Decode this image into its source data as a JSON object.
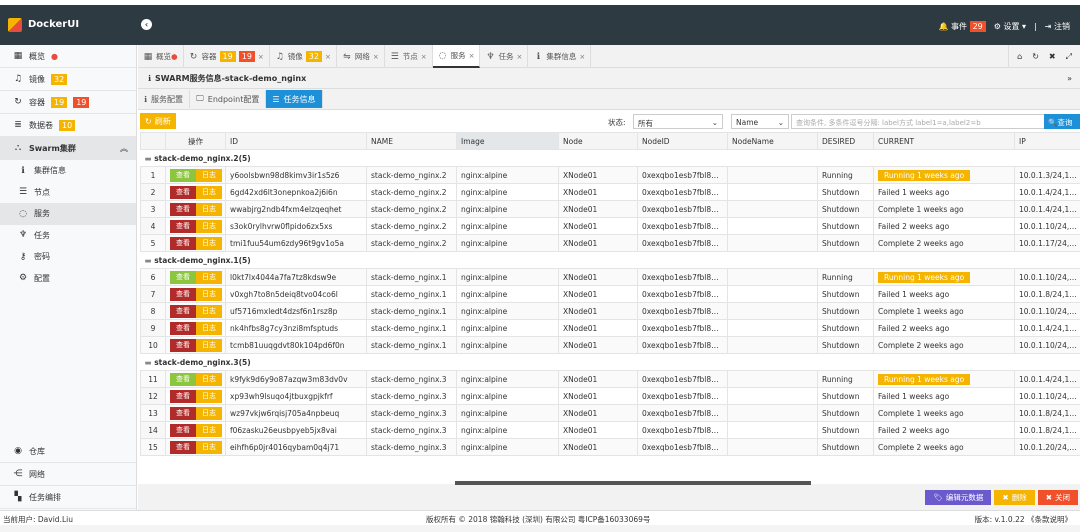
{
  "app": {
    "title": "DockerUI"
  },
  "header": {
    "events_label": "事件",
    "events_count": "29",
    "settings_label": "设置",
    "logout_label": "注销"
  },
  "sidebar": {
    "items": [
      {
        "label": "概览",
        "icon": "windows-icon",
        "dot": true
      },
      {
        "label": "镜像",
        "icon": "headphones-icon",
        "badge": "32"
      },
      {
        "label": "容器",
        "icon": "refresh-icon",
        "badge": "19",
        "badge2": "19"
      },
      {
        "label": "数据卷",
        "icon": "database-icon",
        "badge": "10"
      },
      {
        "label": "Swarm集群",
        "icon": "sitemap-icon",
        "expanded": true
      }
    ],
    "sub": [
      {
        "label": "集群信息",
        "icon": "info-icon"
      },
      {
        "label": "节点",
        "icon": "server-icon"
      },
      {
        "label": "服务",
        "icon": "spinner-icon",
        "active": true
      },
      {
        "label": "任务",
        "icon": "rebel-icon"
      },
      {
        "label": "密码",
        "icon": "key-icon"
      },
      {
        "label": "配置",
        "icon": "gear-icon"
      }
    ],
    "bottom": [
      {
        "label": "仓库",
        "icon": "repo-icon"
      },
      {
        "label": "网络",
        "icon": "network-icon"
      },
      {
        "label": "任务编排",
        "icon": "compose-icon"
      }
    ]
  },
  "tabs": [
    {
      "label": "概览",
      "icon": "windows-icon"
    },
    {
      "label": "容器",
      "icon": "refresh-icon",
      "b1": "19",
      "b2": "19"
    },
    {
      "label": "镜像",
      "icon": "headphones-icon",
      "b1": "32"
    },
    {
      "label": "网络",
      "icon": "usb-icon"
    },
    {
      "label": "节点",
      "icon": "server-icon"
    },
    {
      "label": "服务",
      "icon": "spinner-icon",
      "active": true
    },
    {
      "label": "任务",
      "icon": "rebel-icon"
    },
    {
      "label": "集群信息",
      "icon": "info-icon"
    }
  ],
  "breadcrumb": "SWARM服务信息-stack-demo_nginx",
  "subtabs": [
    {
      "label": "服务配置"
    },
    {
      "label": "Endpoint配置"
    },
    {
      "label": "任务信息",
      "active": true
    }
  ],
  "toolbar": {
    "refresh": "刷新",
    "status_label": "状态:",
    "status_value": "所有",
    "field_value": "Name",
    "search_placeholder": "查询条件, 多条件逗号分隔: label方式 label1=a,label2=b",
    "search_btn": "查询"
  },
  "table": {
    "columns": [
      "",
      "操作",
      "ID",
      "NAME",
      "Image",
      "Node",
      "NodeID",
      "NodeName",
      "DESIRED",
      "CURRENT",
      "IP"
    ],
    "view_label": "查看",
    "log_label": "日志",
    "groups": [
      {
        "title": "stack-demo_nginx.2(5)",
        "rows": [
          [
            "1",
            "y6oolsbwn98d8kimv3ir1s5z6",
            "stack-demo_nginx.2",
            "nginx:alpine",
            "XNode01",
            "0xexqbo1esb7fbl8yt...",
            "",
            "Running",
            "Running 1 weeks ago",
            "10.0.1.3/24,10.0"
          ],
          [
            "2",
            "6gd42xd6lt3onepnkoa2j6i6n",
            "stack-demo_nginx.2",
            "nginx:alpine",
            "XNode01",
            "0xexqbo1esb7fbl8yt...",
            "",
            "Shutdown",
            "Failed 1 weeks ago",
            "10.0.1.4/24,10.0"
          ],
          [
            "3",
            "wwabjrg2ndb4fxm4elzqeqhet",
            "stack-demo_nginx.2",
            "nginx:alpine",
            "XNode01",
            "0xexqbo1esb7fbl8yt...",
            "",
            "Shutdown",
            "Complete 1 weeks ago",
            "10.0.1.4/24,10.0"
          ],
          [
            "4",
            "s3ok0rylhvrw0flpido6zx5xs",
            "stack-demo_nginx.2",
            "nginx:alpine",
            "XNode01",
            "0xexqbo1esb7fbl8yt...",
            "",
            "Shutdown",
            "Failed 2 weeks ago",
            "10.0.1.10/24,10."
          ],
          [
            "5",
            "tmi1fuu54um6zdy96t9gv1o5a",
            "stack-demo_nginx.2",
            "nginx:alpine",
            "XNode01",
            "0xexqbo1esb7fbl8yt...",
            "",
            "Shutdown",
            "Complete 2 weeks ago",
            "10.0.1.17/24,10."
          ]
        ]
      },
      {
        "title": "stack-demo_nginx.1(5)",
        "rows": [
          [
            "6",
            "l0kt7lx4044a7fa7tz8kdsw9e",
            "stack-demo_nginx.1",
            "nginx:alpine",
            "XNode01",
            "0xexqbo1esb7fbl8yt...",
            "",
            "Running",
            "Running 1 weeks ago",
            "10.0.1.10/24,10."
          ],
          [
            "7",
            "v0xgh7to8n5deiq8tvo04co6l",
            "stack-demo_nginx.1",
            "nginx:alpine",
            "XNode01",
            "0xexqbo1esb7fbl8yt...",
            "",
            "Shutdown",
            "Failed 1 weeks ago",
            "10.0.1.8/24,10.0"
          ],
          [
            "8",
            "uf5716mxledt4dzsf6n1rsz8p",
            "stack-demo_nginx.1",
            "nginx:alpine",
            "XNode01",
            "0xexqbo1esb7fbl8yt...",
            "",
            "Shutdown",
            "Complete 1 weeks ago",
            "10.0.1.10/24,10."
          ],
          [
            "9",
            "nk4hfbs8g7cy3nzi8mfsptuds",
            "stack-demo_nginx.1",
            "nginx:alpine",
            "XNode01",
            "0xexqbo1esb7fbl8yt...",
            "",
            "Shutdown",
            "Failed 2 weeks ago",
            "10.0.1.4/24,10.0"
          ],
          [
            "10",
            "tcmb81uuqgdvt80k104pd6f0n",
            "stack-demo_nginx.1",
            "nginx:alpine",
            "XNode01",
            "0xexqbo1esb7fbl8yt...",
            "",
            "Shutdown",
            "Complete 2 weeks ago",
            "10.0.1.10/24,10."
          ]
        ]
      },
      {
        "title": "stack-demo_nginx.3(5)",
        "rows": [
          [
            "11",
            "k9fyk9d6y9o87azqw3m83dv0v",
            "stack-demo_nginx.3",
            "nginx:alpine",
            "XNode01",
            "0xexqbo1esb7fbl8yt...",
            "",
            "Running",
            "Running 1 weeks ago",
            "10.0.1.4/24,10.0"
          ],
          [
            "12",
            "xp93wh9lsuqo4jtbuxgpjkfrf",
            "stack-demo_nginx.3",
            "nginx:alpine",
            "XNode01",
            "0xexqbo1esb7fbl8yt...",
            "",
            "Shutdown",
            "Failed 1 weeks ago",
            "10.0.1.10/24,10."
          ],
          [
            "13",
            "wz97vkjw6rqisj705a4npbeuq",
            "stack-demo_nginx.3",
            "nginx:alpine",
            "XNode01",
            "0xexqbo1esb7fbl8yt...",
            "",
            "Shutdown",
            "Complete 1 weeks ago",
            "10.0.1.8/24,10.0"
          ],
          [
            "14",
            "f06zasku26eusbpyeb5jx8vai",
            "stack-demo_nginx.3",
            "nginx:alpine",
            "XNode01",
            "0xexqbo1esb7fbl8yt...",
            "",
            "Shutdown",
            "Failed 2 weeks ago",
            "10.0.1.8/24,10.0"
          ],
          [
            "15",
            "eihfh6p0jr4016qybam0q4j71",
            "stack-demo_nginx.3",
            "nginx:alpine",
            "XNode01",
            "0xexqbo1esb7fbl8yt...",
            "",
            "Shutdown",
            "Complete 2 weeks ago",
            "10.0.1.20/24,10."
          ]
        ]
      }
    ]
  },
  "actions": {
    "edit_meta": "编辑元数据",
    "delete": "删除",
    "close": "关闭"
  },
  "colors": {
    "header": "#2d3a41",
    "accent": "#1e90d8",
    "orange": "#f5b400",
    "red": "#f0502a",
    "purple": "#6a5acd",
    "green": "#8cc63e",
    "darkred": "#b22b2b"
  },
  "footer": {
    "user": "当前用户: David.Liu",
    "copyright": "版权所有 © 2018 锦翰科技 (深圳) 有限公司 粤ICP备16033069号",
    "version": "版本: v.1.0.22 《条款说明》"
  }
}
